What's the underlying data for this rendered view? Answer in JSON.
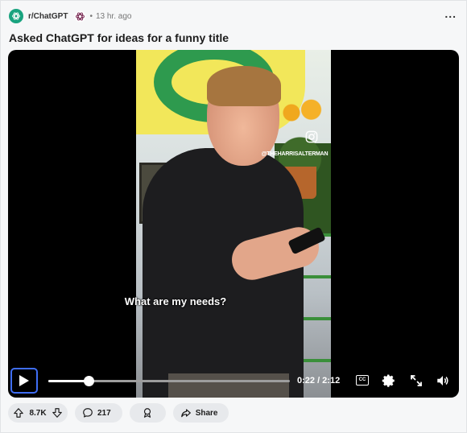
{
  "post": {
    "subreddit": "r/ChatGPT",
    "separator": "•",
    "time": "13 hr. ago",
    "more": "...",
    "title": "Asked ChatGPT for ideas for a funny title"
  },
  "video": {
    "watermark_handle": "@THEHARRISALTERMAN",
    "caption": "What are my needs?",
    "timecode": "0:22 / 2:12",
    "progress_fraction": 0.166,
    "cc_label": "CC"
  },
  "actions": {
    "upvotes": "8.7K",
    "comments": "217",
    "share": "Share"
  },
  "colors": {
    "subreddit_icon": "#19a37f",
    "focus_ring": "#3f6ef5",
    "pill_bg": "#e7e9ec"
  },
  "icons": [
    "chatgpt-logo-icon",
    "openai-flair-icon",
    "more-options-icon",
    "instagram-icon",
    "play-icon",
    "cc-icon",
    "gear-icon",
    "fullscreen-icon",
    "volume-icon",
    "upvote-icon",
    "downvote-icon",
    "comment-icon",
    "award-icon",
    "share-icon"
  ]
}
